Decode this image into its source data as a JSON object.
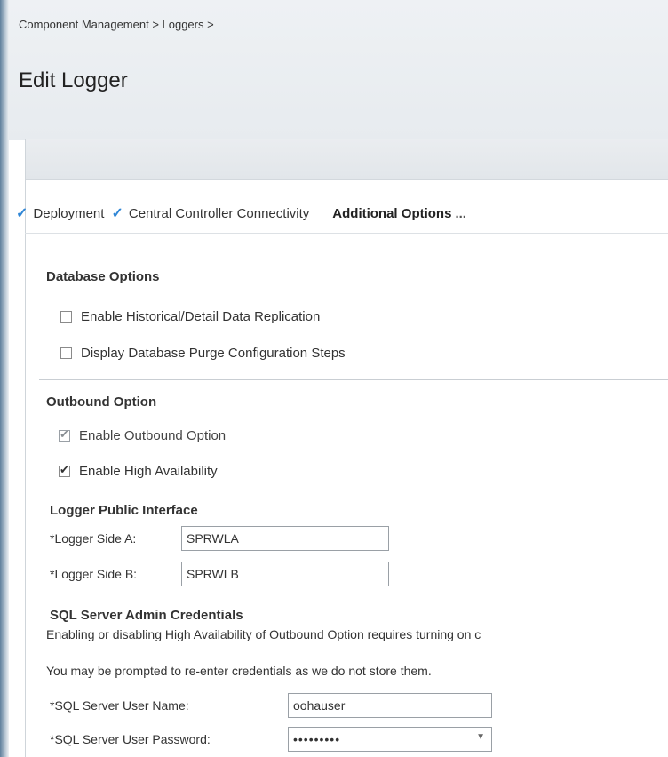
{
  "breadcrumb": "Component Management > Loggers >",
  "page_title": "Edit Logger",
  "steps": [
    {
      "label": "Deployment",
      "done": true
    },
    {
      "label": "Central Controller Connectivity",
      "done": true
    },
    {
      "label": "Additional Options",
      "current": true
    }
  ],
  "steps_more": "...",
  "database_options": {
    "title": "Database Options",
    "items": [
      {
        "label": "Enable Historical/Detail Data Replication",
        "checked": false
      },
      {
        "label": "Display Database Purge Configuration Steps",
        "checked": false
      }
    ]
  },
  "outbound_option": {
    "title": "Outbound Option",
    "items": [
      {
        "label": "Enable Outbound Option",
        "checked": true,
        "disabled": true
      },
      {
        "label": "Enable High Availability",
        "checked": true
      }
    ]
  },
  "logger_public_interface": {
    "title": "Logger Public Interface",
    "side_a_label": "*Logger Side A:",
    "side_a_value": "SPRWLA",
    "side_b_label": "*Logger Side B:",
    "side_b_value": "SPRWLB"
  },
  "sql_credentials": {
    "title": "SQL Server Admin Credentials",
    "note1": "Enabling or disabling High Availability of Outbound Option requires turning on c",
    "note2": "You may be prompted to re-enter credentials as we do not store them.",
    "username_label": "*SQL Server User Name:",
    "username_value": "oohauser",
    "password_label": "*SQL Server User Password:",
    "password_value": "•••••••••"
  },
  "colors": {
    "check_accent": "#2f86d6"
  },
  "icons": {
    "step_done": "check-icon",
    "password_toggle": "dropdown-icon"
  }
}
